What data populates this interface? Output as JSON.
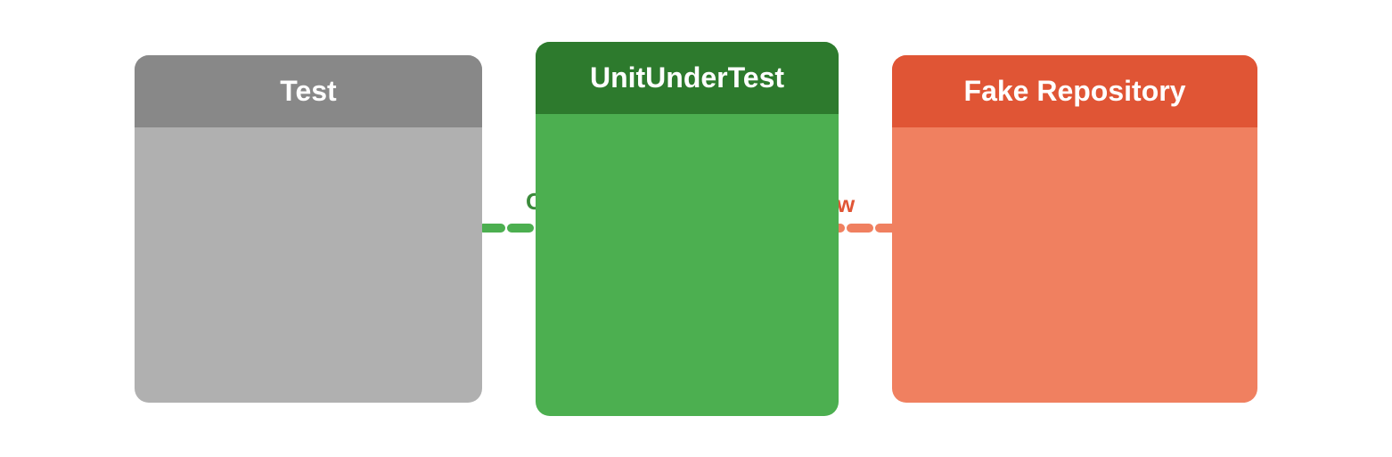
{
  "boxes": {
    "test": {
      "label": "Test",
      "header_bg": "#888888",
      "body_bg": "#b0b0b0"
    },
    "unit": {
      "label": "UnitUnderTest",
      "header_bg": "#2d7a2d",
      "body_bg": "#4caf50"
    },
    "fake": {
      "label": "Fake Repository",
      "header_bg": "#e05535",
      "body_bg": "#f08060"
    }
  },
  "labels": {
    "output": "Output",
    "flow": "Flow"
  },
  "colors": {
    "green_line": "#4caf50",
    "orange_line": "#f08060",
    "white": "#ffffff",
    "plug_color": "#d0d0d0"
  }
}
